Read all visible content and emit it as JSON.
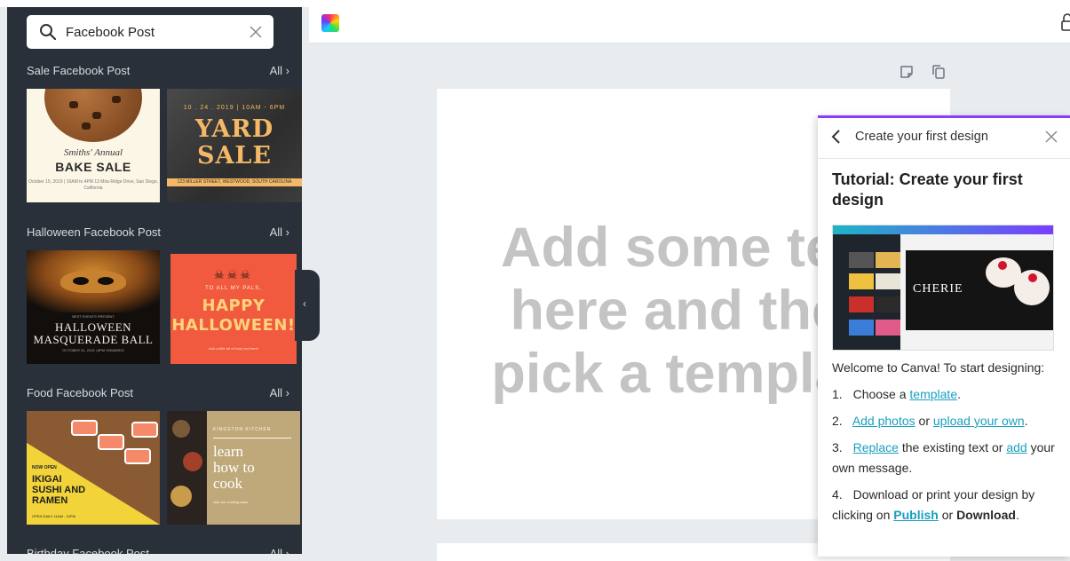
{
  "search": {
    "value": "Facebook Post"
  },
  "categories": [
    {
      "title": "Sale Facebook Post",
      "all": "All"
    },
    {
      "title": "Halloween Facebook Post",
      "all": "All"
    },
    {
      "title": "Food Facebook Post",
      "all": "All"
    },
    {
      "title": "Birthday Facebook Post",
      "all": "All"
    }
  ],
  "templates": {
    "bake_sale": {
      "script": "Smiths' Annual",
      "title": "BAKE SALE",
      "fine_print": "October 15, 2019 | 10AM to 4PM\n13 Mira Ridge Drive, San Diego, California"
    },
    "yard_sale": {
      "date": "10 . 24 . 2019 | 10AM - 6PM",
      "line1": "YARD",
      "line2": "SALE",
      "address": "123 MILLER STREET, WESTWOOD, SOUTH CAROLINA"
    },
    "masquerade": {
      "top": "BEST EVENTS PRESENT",
      "line1": "HALLOWEEN",
      "line2": "MASQUERADE BALL",
      "bottom": "OCTOBER 31, 2019 | 8PM ONWARDS"
    },
    "happy_halloween": {
      "skulls": "☠☠☠",
      "sub": "TO ALL MY PALS,",
      "line1": "HAPPY",
      "line2": "HALLOWEEN!",
      "bottom": "Add a little bit of body text here!"
    },
    "sushi": {
      "now": "NOW OPEN",
      "line1": "IKIGAI",
      "line2": "SUSHI AND",
      "line3": "RAMEN",
      "bottom": "OPEN DAILY 11AM - 10PM"
    },
    "cook": {
      "kitchen": "KINGSTON KITCHEN",
      "line1": "learn",
      "line2": "how to",
      "line3": "cook",
      "bottom": "Join our cooking class"
    }
  },
  "canvas": {
    "line1": "Add some text",
    "line2": "here and then",
    "line3": "pick a template"
  },
  "tutorial": {
    "header": "Create your first design",
    "title": "Tutorial: Create your first design",
    "shot_label": "CHERIE",
    "intro": "Welcome to Canva! To start designing:",
    "steps": {
      "s1": {
        "num": "1.",
        "pre": "Choose a",
        "link": "template",
        "post": "."
      },
      "s2": {
        "num": "2.",
        "link1": "Add photos",
        "mid": "or",
        "link2": "upload your own",
        "post": "."
      },
      "s3": {
        "num": "3.",
        "link1": "Replace",
        "mid": "the existing text or",
        "link2": "add",
        "post": "your own message."
      },
      "s4": {
        "num": "4.",
        "pre": "Download or print your design by clicking on",
        "link": "Publish",
        "mid": "or",
        "bold": "Download",
        "post": "."
      }
    }
  },
  "colors": {
    "sidebar": "#293039",
    "accent": "#8b3dff",
    "link": "#1a9fc0"
  }
}
